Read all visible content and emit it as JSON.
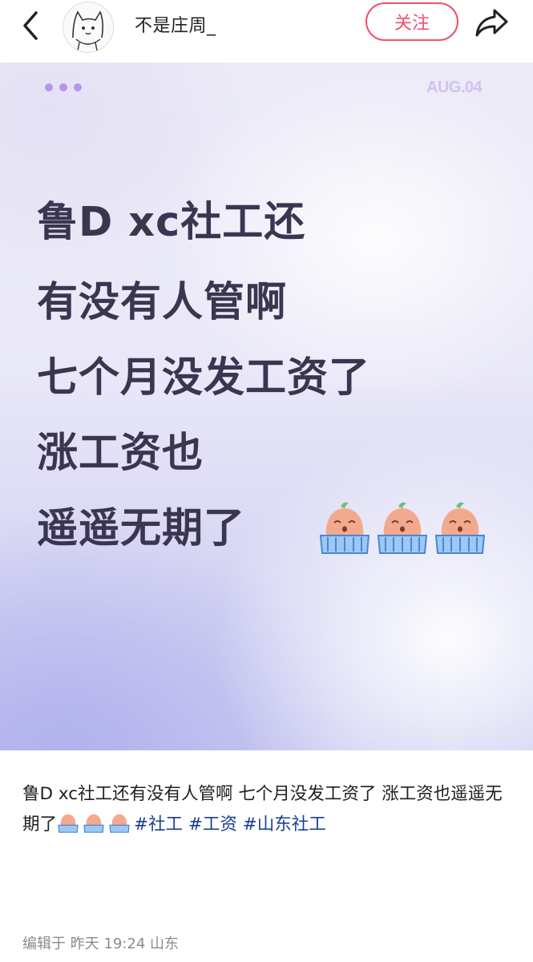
{
  "header": {
    "username": "不是庄周_",
    "follow_label": "关注"
  },
  "card": {
    "date": "AUG.04",
    "lines": [
      "鲁D xc",
      "社工",
      "还",
      "有没有人管啊",
      "七个月没发工资了",
      "涨工资也",
      "遥遥无期了"
    ]
  },
  "caption": {
    "text": "鲁D xc社工还有没有人管啊 七个月没发工资了 涨工资也遥遥无期了",
    "tags": [
      "#社工",
      "#工资",
      "#山东社工"
    ]
  },
  "meta": {
    "edited_text": "编辑于  昨天 19:24 山东"
  },
  "icons": [
    "back-icon",
    "avatar-cat-sketch",
    "share-icon",
    "crying-emoji-icon"
  ],
  "colors": {
    "accent": "#f0506e",
    "tag": "#1a3f8f",
    "highlight": "#9fe86b",
    "headline": "#3b3550"
  }
}
